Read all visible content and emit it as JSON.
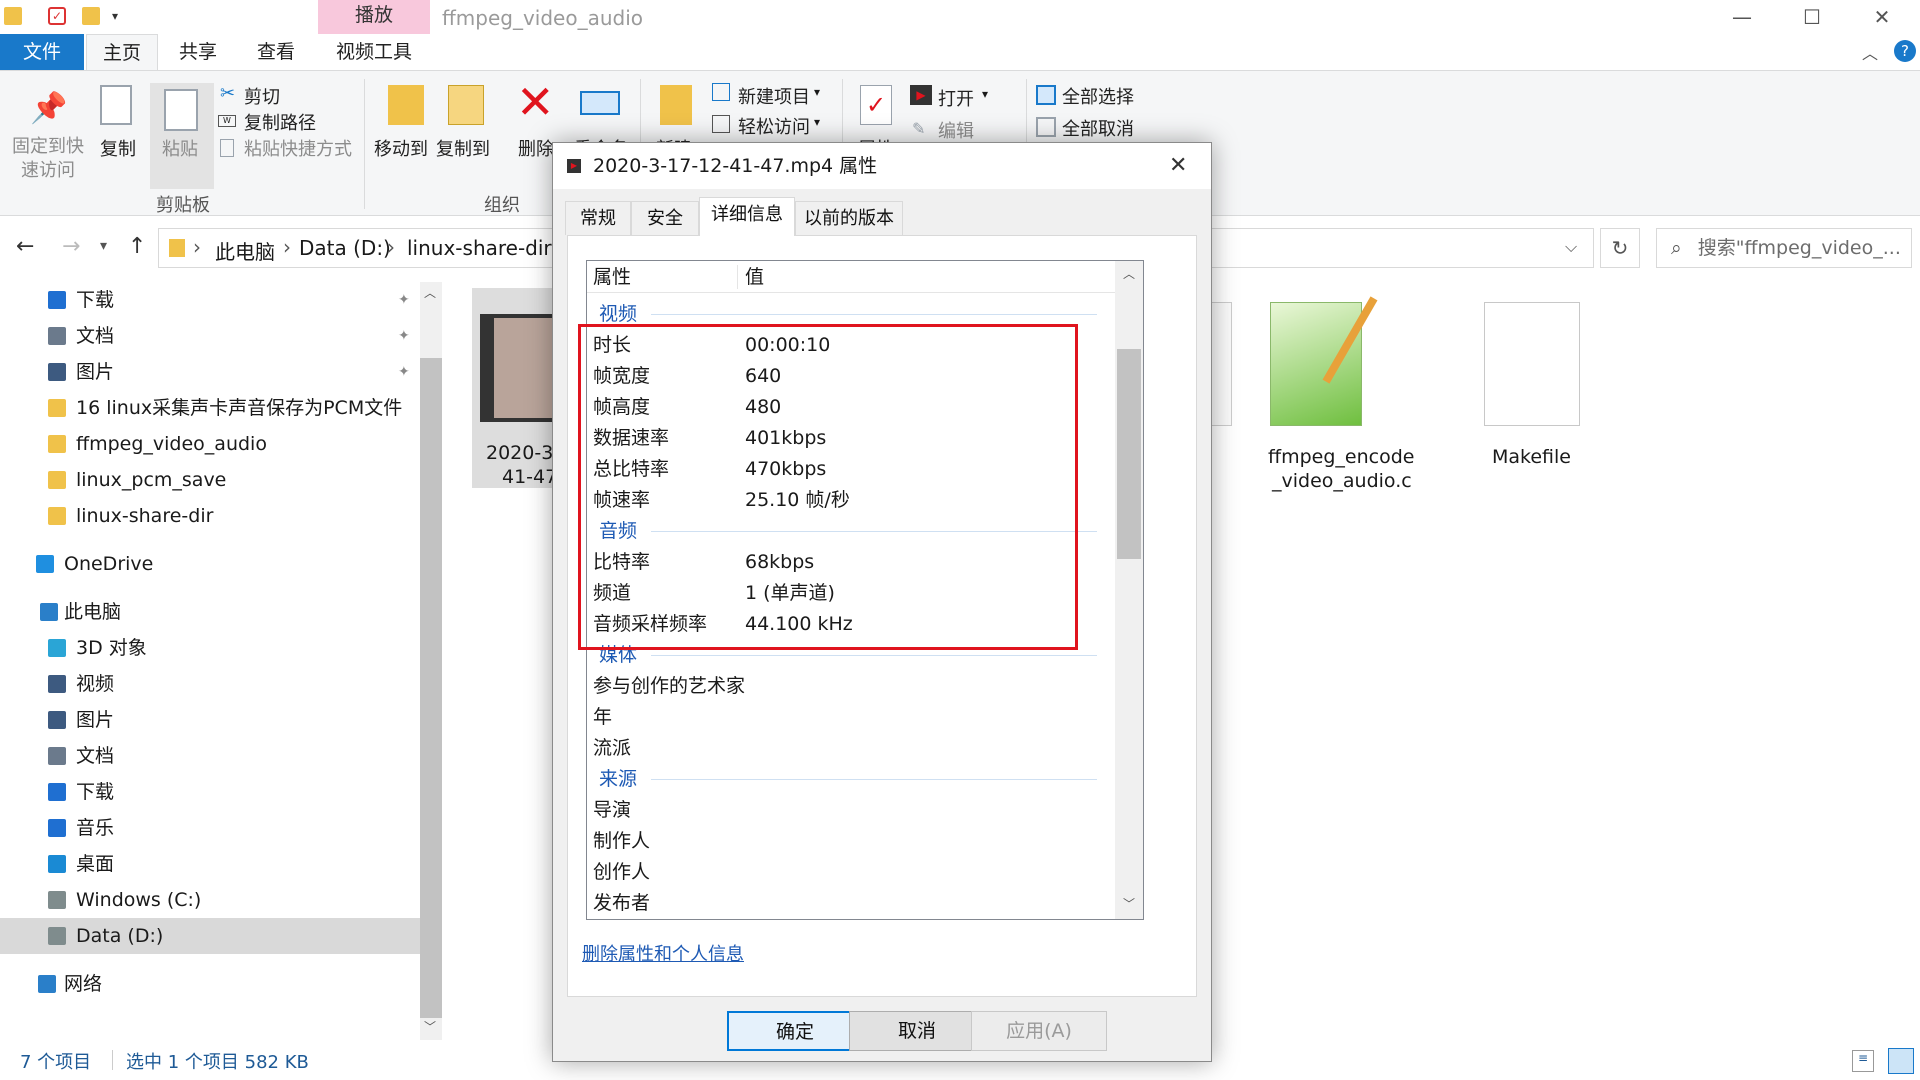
{
  "window": {
    "title": "ffmpeg_video_audio",
    "context_group": "播放",
    "controls": [
      "—",
      "☐",
      "✕"
    ]
  },
  "tabs": [
    "文件",
    "主页",
    "共享",
    "查看",
    "视频工具"
  ],
  "ribbon": {
    "clipboard": {
      "pin": "固定到快速访问",
      "pin_line1": "固定到快",
      "pin_line2": "速访问",
      "copy": "复制",
      "paste": "粘贴",
      "cut": "剪切",
      "copy_path": "复制路径",
      "paste_shortcut": "粘贴快捷方式",
      "label": "剪贴板"
    },
    "organize": {
      "move_to": "移动到",
      "copy_to": "复制到",
      "delete": "删除",
      "rename": "重命名",
      "label": "组织"
    },
    "new": {
      "new_folder": "新建",
      "new_item": "新建项目",
      "easy_access": "轻松访问"
    },
    "open": {
      "properties": "属性",
      "open": "打开",
      "edit": "编辑"
    },
    "select": {
      "select_all": "全部选择",
      "select_none": "全部取消"
    }
  },
  "nav": {
    "breadcrumb": [
      "此电脑",
      "Data (D:)",
      "linux-share-dir"
    ],
    "search_placeholder": "搜索\"ffmpeg_video_..."
  },
  "sidebar": {
    "quick": [
      {
        "label": "下载",
        "icon": "download-arrow-icon",
        "color": "#1f6fd1",
        "pinned": true
      },
      {
        "label": "文档",
        "icon": "document-icon",
        "color": "#6b7a8c",
        "pinned": true
      },
      {
        "label": "图片",
        "icon": "picture-icon",
        "color": "#3d5a80",
        "pinned": true
      },
      {
        "label": "16 linux采集声卡声音保存为PCM文件",
        "icon": "folder-icon",
        "color": "#f0c24a",
        "pinned": false
      },
      {
        "label": "ffmpeg_video_audio",
        "icon": "folder-icon",
        "color": "#f0c24a",
        "pinned": false
      },
      {
        "label": "linux_pcm_save",
        "icon": "folder-icon",
        "color": "#f0c24a",
        "pinned": false
      },
      {
        "label": "linux-share-dir",
        "icon": "folder-icon",
        "color": "#f0c24a",
        "pinned": false
      }
    ],
    "onedrive": "OneDrive",
    "this_pc": "此电脑",
    "pc_items": [
      {
        "label": "3D 对象",
        "icon": "cube-icon",
        "color": "#2aa5d6"
      },
      {
        "label": "视频",
        "icon": "film-icon",
        "color": "#3d5a80"
      },
      {
        "label": "图片",
        "icon": "picture-icon",
        "color": "#3d5a80"
      },
      {
        "label": "文档",
        "icon": "document-icon",
        "color": "#6b7a8c"
      },
      {
        "label": "下载",
        "icon": "download-arrow-icon",
        "color": "#1f6fd1"
      },
      {
        "label": "音乐",
        "icon": "music-note-icon",
        "color": "#1f6fd1"
      },
      {
        "label": "桌面",
        "icon": "desktop-icon",
        "color": "#1a8ad4"
      },
      {
        "label": "Windows (C:)",
        "icon": "drive-icon",
        "color": "#7f8c8d"
      },
      {
        "label": "Data (D:)",
        "icon": "drive-icon",
        "color": "#7f8c8d",
        "selected": true
      }
    ],
    "network": "网络"
  },
  "files": [
    {
      "name_line1": "2020-3-",
      "name_line2": "41-47",
      "kind": "video-thumbnail",
      "selected": true
    },
    {
      "name_line1": "ffmpeg_encode",
      "name_line2": "_video_audio.c",
      "kind": "notepad-file"
    },
    {
      "name_line1": "Makefile",
      "name_line2": "",
      "kind": "blank-file"
    }
  ],
  "status": {
    "count": "7 个项目",
    "selected": "选中 1 个项目  582 KB"
  },
  "dialog": {
    "title": "2020-3-17-12-41-47.mp4 属性",
    "tabs": [
      "常规",
      "安全",
      "详细信息",
      "以前的版本"
    ],
    "active_tab": 2,
    "col_property": "属性",
    "col_value": "值",
    "groups": {
      "video": "视频",
      "audio": "音频",
      "media": "媒体",
      "origin": "来源"
    },
    "video_rows": [
      {
        "k": "时长",
        "v": "00:00:10"
      },
      {
        "k": "帧宽度",
        "v": "640"
      },
      {
        "k": "帧高度",
        "v": "480"
      },
      {
        "k": "数据速率",
        "v": "401kbps"
      },
      {
        "k": "总比特率",
        "v": "470kbps"
      },
      {
        "k": "帧速率",
        "v": "25.10 帧/秒"
      }
    ],
    "audio_rows": [
      {
        "k": "比特率",
        "v": "68kbps"
      },
      {
        "k": "频道",
        "v": "1 (单声道)"
      },
      {
        "k": "音频采样频率",
        "v": "44.100 kHz"
      }
    ],
    "media_rows": [
      {
        "k": "参与创作的艺术家",
        "v": ""
      },
      {
        "k": "年",
        "v": ""
      },
      {
        "k": "流派",
        "v": ""
      }
    ],
    "origin_rows": [
      {
        "k": "导演",
        "v": ""
      },
      {
        "k": "制作人",
        "v": ""
      },
      {
        "k": "创作人",
        "v": ""
      },
      {
        "k": "发布者",
        "v": ""
      }
    ],
    "remove_link": "删除属性和个人信息",
    "ok": "确定",
    "cancel": "取消",
    "apply": "应用(A)"
  },
  "colors": {
    "accent": "#1979ca",
    "highlight_box": "#e0141e",
    "link": "#1e5ab4"
  }
}
